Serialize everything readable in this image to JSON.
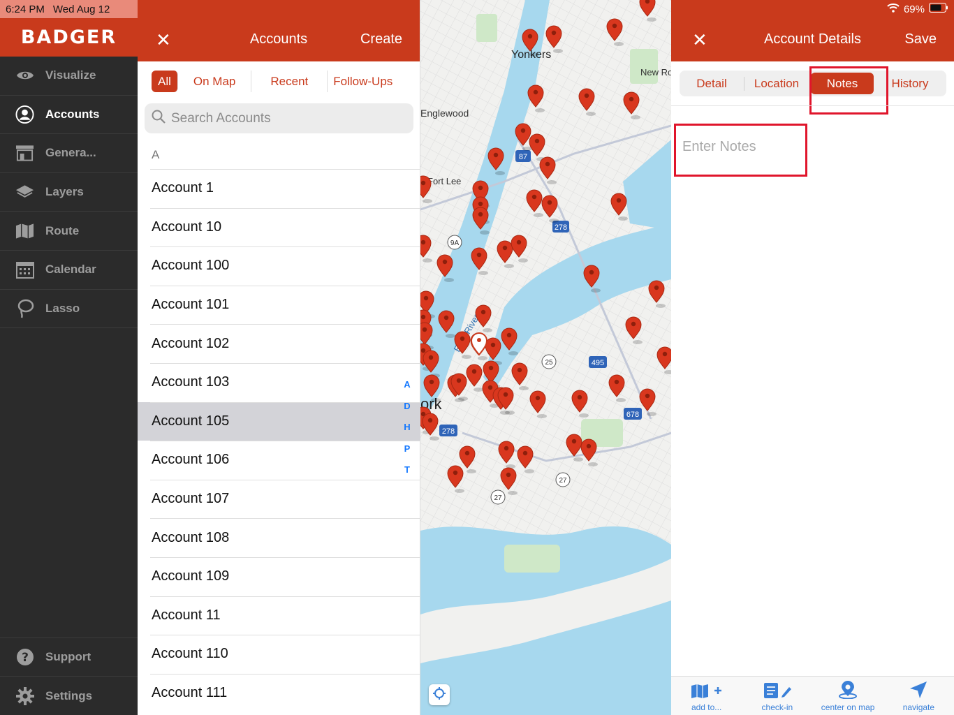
{
  "status": {
    "time": "6:24 PM",
    "date": "Wed Aug 12",
    "battery": "69%"
  },
  "brand": "BADGER",
  "nav": {
    "items": [
      {
        "label": "Visualize",
        "icon": "eye-icon",
        "active": false
      },
      {
        "label": "Accounts",
        "icon": "user-circle-icon",
        "active": true
      },
      {
        "label": "Genera...",
        "icon": "store-icon",
        "active": false
      },
      {
        "label": "Layers",
        "icon": "layers-icon",
        "active": false
      },
      {
        "label": "Route",
        "icon": "map-icon",
        "active": false
      },
      {
        "label": "Calendar",
        "icon": "calendar-icon",
        "active": false
      },
      {
        "label": "Lasso",
        "icon": "lasso-icon",
        "active": false
      }
    ],
    "bottom": [
      {
        "label": "Support",
        "icon": "help-icon"
      },
      {
        "label": "Settings",
        "icon": "gear-icon"
      }
    ]
  },
  "accounts": {
    "title": "Accounts",
    "create_label": "Create",
    "filters": [
      "All",
      "On Map",
      "Recent",
      "Follow-Ups"
    ],
    "selected_filter": "All",
    "search_placeholder": "Search Accounts",
    "section": "A",
    "rows": [
      "Account 1",
      "Account 10",
      "Account 100",
      "Account 101",
      "Account 102",
      "Account 103",
      "Account 105",
      "Account 106",
      "Account 107",
      "Account 108",
      "Account 109",
      "Account 11",
      "Account 110",
      "Account 111"
    ],
    "selected_row": "Account 105",
    "index_letters": [
      "A",
      "D",
      "H",
      "P",
      "T"
    ]
  },
  "map": {
    "labels": [
      "Yonkers",
      "Englewood",
      "Fort Lee",
      "New Ro",
      "ork",
      "East River"
    ],
    "shields": [
      "87",
      "278",
      "9A",
      "25",
      "495",
      "678",
      "278",
      "27",
      "27"
    ]
  },
  "details": {
    "title": "Account Details",
    "save_label": "Save",
    "tabs": [
      "Detail",
      "Location",
      "Notes",
      "History"
    ],
    "selected_tab": "Notes",
    "notes_placeholder": "Enter Notes",
    "toolbar": [
      {
        "label": "add to...",
        "icon": "map-add-icon"
      },
      {
        "label": "check-in",
        "icon": "checkin-icon"
      },
      {
        "label": "center on map",
        "icon": "pin-icon"
      },
      {
        "label": "navigate",
        "icon": "navigate-icon"
      }
    ]
  },
  "colors": {
    "brand": "#c93a1c",
    "sidebar": "#2b2b2b",
    "water": "#a7d8ee",
    "park": "#cfe8c8",
    "link": "#1478ff",
    "highlight": "#e0152b"
  }
}
